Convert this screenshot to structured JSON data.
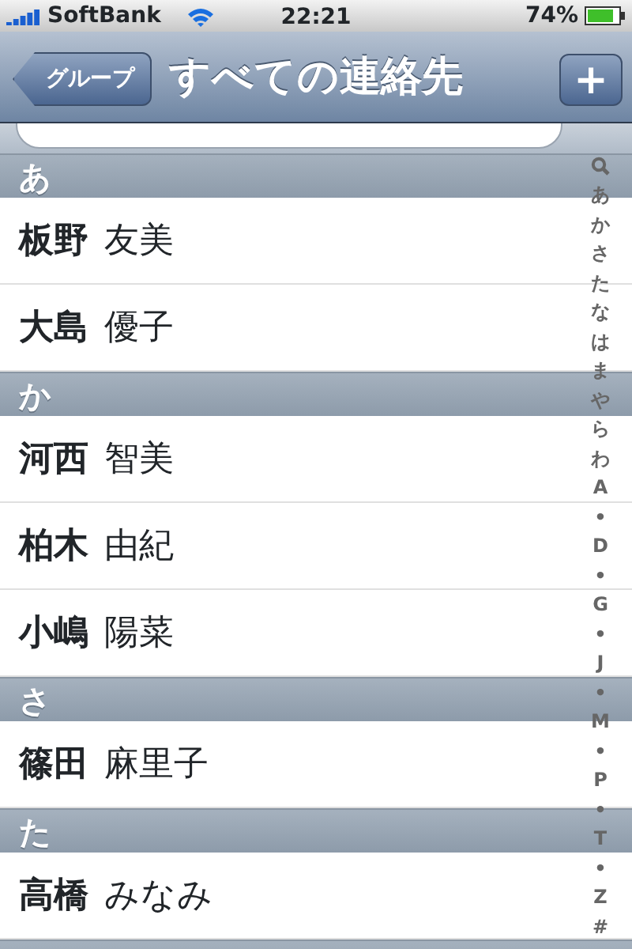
{
  "status_bar": {
    "carrier": "SoftBank",
    "time": "22:21",
    "battery": "74%"
  },
  "nav_bar": {
    "back_button": "グループ",
    "title": "すべての連絡先",
    "add_button": "+"
  },
  "sections": [
    {
      "header": "あ",
      "contacts": [
        {
          "family": "板野",
          "given": "友美"
        },
        {
          "family": "大島",
          "given": "優子"
        }
      ]
    },
    {
      "header": "か",
      "contacts": [
        {
          "family": "河西",
          "given": "智美"
        },
        {
          "family": "柏木",
          "given": "由紀"
        },
        {
          "family": "小嶋",
          "given": "陽菜"
        }
      ]
    },
    {
      "header": "さ",
      "contacts": [
        {
          "family": "篠田",
          "given": "麻里子"
        }
      ]
    },
    {
      "header": "た",
      "contacts": [
        {
          "family": "高橋",
          "given": "みなみ"
        }
      ]
    }
  ],
  "index": [
    "あ",
    "か",
    "さ",
    "た",
    "な",
    "は",
    "ま",
    "や",
    "ら",
    "わ",
    "A",
    "•",
    "D",
    "•",
    "G",
    "•",
    "J",
    "•",
    "M",
    "•",
    "P",
    "•",
    "T",
    "•",
    "Z",
    "#"
  ]
}
